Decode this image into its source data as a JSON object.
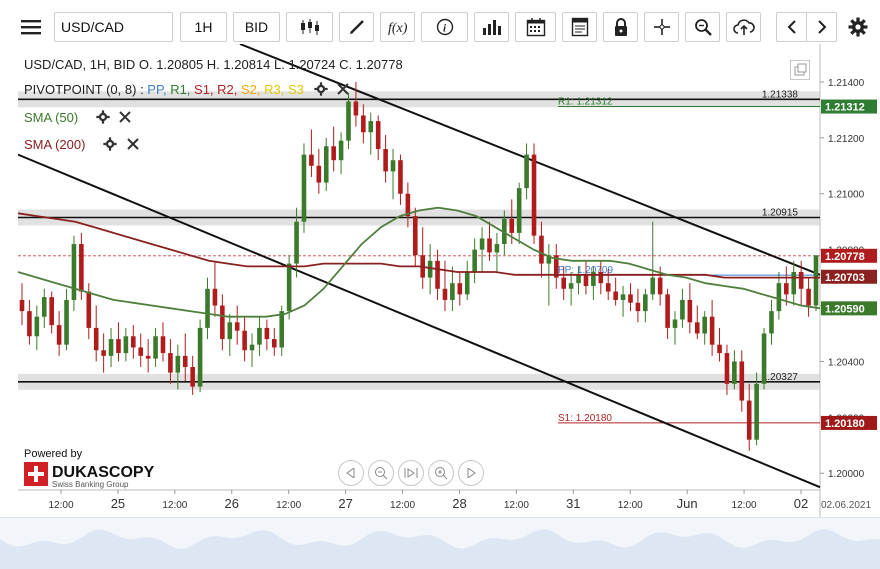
{
  "toolbar": {
    "symbol": "USD/CAD",
    "timeframe": "1H",
    "price_side": "BID",
    "icons": [
      "menu-icon",
      "candle-type-icon",
      "draw-icon",
      "function-icon",
      "info-icon",
      "indicators-icon",
      "calendar-icon",
      "report-icon",
      "lock-icon",
      "crosshair-icon",
      "zoom-icon",
      "upload-icon",
      "chevron-left-icon",
      "chevron-right-icon",
      "gear-icon"
    ]
  },
  "legend": {
    "ohlc": "USD/CAD, 1H, BID   O. 1.20805 H. 1.20814 L. 1.20724 C. 1.20778",
    "pivot_name": "PIVOTPOINT (0, 8)",
    "pivot_sep": " : ",
    "pivot_items": [
      {
        "label": "PP",
        "color": "#3b7fd6"
      },
      {
        "label": "R1",
        "color": "#2e7d32"
      },
      {
        "label": "S1",
        "color": "#b02424"
      },
      {
        "label": "R2",
        "color": "#b02424"
      },
      {
        "label": "S2",
        "color": "#f0a800"
      },
      {
        "label": "R3",
        "color": "#e6c800"
      },
      {
        "label": "S3",
        "color": "#e6c800"
      }
    ],
    "sma50": "SMA (50)",
    "sma200": "SMA (200)"
  },
  "branding": {
    "powered_by": "Powered by",
    "brand": "DUKASCOPY",
    "brand_sub": "Swiss Banking Group"
  },
  "colors": {
    "up": "#3a7a2a",
    "down": "#b01c1c",
    "sma50": "#4f7f3c",
    "sma200": "#8b2020",
    "pp": "#3b7fd6",
    "r1": "#2e7d32",
    "s1": "#b02424",
    "band": "#c9c9c9",
    "trend": "#111111"
  },
  "chart_data": {
    "type": "candlestick",
    "symbol": "USD/CAD",
    "ylim": [
      1.1994,
      1.215
    ],
    "yticks": [
      1.2,
      1.202,
      1.204,
      1.206,
      1.208,
      1.21,
      1.212,
      1.214
    ],
    "xticks": [
      "12:00",
      "25",
      "12:00",
      "26",
      "12:00",
      "27",
      "12:00",
      "28",
      "12:00",
      "31",
      "12:00",
      "Jun",
      "12:00",
      "02"
    ],
    "date_label": "02.06.2021",
    "pivot_levels": [
      {
        "name": "R1",
        "value": 1.21312,
        "label": "R1: 1.21312"
      },
      {
        "name": "PP",
        "value": 1.20709,
        "label": "PP: 1.20709"
      },
      {
        "name": "S1",
        "value": 1.2018,
        "label": "S1: 1.20180"
      }
    ],
    "support_resistance": [
      1.21338,
      1.20915,
      1.20327
    ],
    "last_price": 1.20778,
    "sma50_last": 1.2059,
    "sma200_last": 1.20703,
    "price_tags": [
      {
        "label": "1.21312",
        "value": 1.21312,
        "color": "#2e7d32"
      },
      {
        "label": "1.20778",
        "value": 1.20778,
        "color": "#b01c1c"
      },
      {
        "label": "1.20703",
        "value": 1.20703,
        "color": "#8b2020"
      },
      {
        "label": "1.20590",
        "value": 1.2059,
        "color": "#3a7a2a"
      },
      {
        "label": "1.20180",
        "value": 1.2018,
        "color": "#a01818"
      }
    ],
    "candles": [
      [
        1.2062,
        1.2068,
        1.2053,
        1.2058
      ],
      [
        1.2058,
        1.2062,
        1.2046,
        1.2049
      ],
      [
        1.2049,
        1.206,
        1.2044,
        1.2056
      ],
      [
        1.2056,
        1.2066,
        1.2052,
        1.2063
      ],
      [
        1.2063,
        1.2065,
        1.205,
        1.2053
      ],
      [
        1.2053,
        1.2058,
        1.2042,
        1.2046
      ],
      [
        1.2046,
        1.2066,
        1.2044,
        1.2062
      ],
      [
        1.2062,
        1.2085,
        1.2058,
        1.2082
      ],
      [
        1.2082,
        1.2086,
        1.2062,
        1.2065
      ],
      [
        1.2065,
        1.2068,
        1.2048,
        1.2052
      ],
      [
        1.2052,
        1.206,
        1.204,
        1.2044
      ],
      [
        1.2044,
        1.205,
        1.2036,
        1.2042
      ],
      [
        1.2042,
        1.2052,
        1.2038,
        1.2048
      ],
      [
        1.2048,
        1.2054,
        1.204,
        1.2043
      ],
      [
        1.2043,
        1.2052,
        1.204,
        1.2049
      ],
      [
        1.2049,
        1.2053,
        1.2041,
        1.2045
      ],
      [
        1.2045,
        1.205,
        1.2038,
        1.2042
      ],
      [
        1.2042,
        1.2048,
        1.2036,
        1.2041
      ],
      [
        1.2041,
        1.2052,
        1.2038,
        1.2049
      ],
      [
        1.2049,
        1.2054,
        1.204,
        1.2043
      ],
      [
        1.2043,
        1.2048,
        1.2032,
        1.2036
      ],
      [
        1.2036,
        1.2046,
        1.203,
        1.2042
      ],
      [
        1.2042,
        1.205,
        1.2033,
        1.2038
      ],
      [
        1.2038,
        1.2042,
        1.2028,
        1.2031
      ],
      [
        1.2031,
        1.2055,
        1.2029,
        1.2052
      ],
      [
        1.2052,
        1.207,
        1.2048,
        1.2066
      ],
      [
        1.2066,
        1.2076,
        1.2056,
        1.206
      ],
      [
        1.206,
        1.2064,
        1.2044,
        1.2048
      ],
      [
        1.2048,
        1.2057,
        1.2042,
        1.2054
      ],
      [
        1.2054,
        1.206,
        1.2046,
        1.2051
      ],
      [
        1.2051,
        1.2056,
        1.204,
        1.2044
      ],
      [
        1.2044,
        1.205,
        1.2038,
        1.2046
      ],
      [
        1.2046,
        1.2056,
        1.2042,
        1.2052
      ],
      [
        1.2052,
        1.2055,
        1.2044,
        1.2048
      ],
      [
        1.2048,
        1.2052,
        1.2042,
        1.2045
      ],
      [
        1.2045,
        1.206,
        1.2042,
        1.2058
      ],
      [
        1.2058,
        1.2078,
        1.2055,
        1.2075
      ],
      [
        1.2075,
        1.2095,
        1.207,
        1.209
      ],
      [
        1.209,
        1.2118,
        1.2086,
        1.2114
      ],
      [
        1.2114,
        1.2123,
        1.2106,
        1.211
      ],
      [
        1.211,
        1.2116,
        1.21,
        1.2104
      ],
      [
        1.2104,
        1.212,
        1.2101,
        1.2117
      ],
      [
        1.2117,
        1.2124,
        1.2108,
        1.2112
      ],
      [
        1.2112,
        1.2122,
        1.2107,
        1.2119
      ],
      [
        1.2119,
        1.2136,
        1.2116,
        1.2133
      ],
      [
        1.2133,
        1.214,
        1.2124,
        1.2128
      ],
      [
        1.2128,
        1.2132,
        1.2118,
        1.2122
      ],
      [
        1.2122,
        1.2129,
        1.2114,
        1.2126
      ],
      [
        1.2126,
        1.2128,
        1.2112,
        1.2116
      ],
      [
        1.2116,
        1.2121,
        1.2104,
        1.2108
      ],
      [
        1.2108,
        1.2116,
        1.2098,
        1.2112
      ],
      [
        1.2112,
        1.2114,
        1.2096,
        1.21
      ],
      [
        1.21,
        1.2104,
        1.2088,
        1.2092
      ],
      [
        1.2092,
        1.2095,
        1.2074,
        1.2078
      ],
      [
        1.2078,
        1.2088,
        1.2066,
        1.207
      ],
      [
        1.207,
        1.2082,
        1.2064,
        1.2076
      ],
      [
        1.2076,
        1.208,
        1.2062,
        1.2066
      ],
      [
        1.2066,
        1.2076,
        1.2058,
        1.2062
      ],
      [
        1.2062,
        1.2074,
        1.2058,
        1.2068
      ],
      [
        1.2068,
        1.2072,
        1.206,
        1.2064
      ],
      [
        1.2064,
        1.2076,
        1.2062,
        1.2072
      ],
      [
        1.2072,
        1.2084,
        1.2068,
        1.208
      ],
      [
        1.208,
        1.2088,
        1.2072,
        1.2084
      ],
      [
        1.2084,
        1.209,
        1.2076,
        1.2079
      ],
      [
        1.2079,
        1.2086,
        1.2072,
        1.2082
      ],
      [
        1.2082,
        1.2094,
        1.2078,
        1.2091
      ],
      [
        1.2091,
        1.2098,
        1.2082,
        1.2086
      ],
      [
        1.2086,
        1.2104,
        1.2082,
        1.2102
      ],
      [
        1.2102,
        1.2118,
        1.2098,
        1.2114
      ],
      [
        1.2114,
        1.2118,
        1.2082,
        1.2085
      ],
      [
        1.2085,
        1.209,
        1.207,
        1.2075
      ],
      [
        1.2075,
        1.2082,
        1.206,
        1.2078
      ],
      [
        1.2078,
        1.2082,
        1.2066,
        1.207
      ],
      [
        1.207,
        1.2074,
        1.2062,
        1.2066
      ],
      [
        1.2066,
        1.2072,
        1.206,
        1.2068
      ],
      [
        1.2068,
        1.2074,
        1.2064,
        1.2071
      ],
      [
        1.2071,
        1.2076,
        1.2064,
        1.2067
      ],
      [
        1.2067,
        1.2074,
        1.2062,
        1.2072
      ],
      [
        1.2072,
        1.2076,
        1.2064,
        1.2068
      ],
      [
        1.2068,
        1.2073,
        1.2062,
        1.2065
      ],
      [
        1.2065,
        1.207,
        1.206,
        1.2062
      ],
      [
        1.2062,
        1.2067,
        1.2056,
        1.2064
      ],
      [
        1.2064,
        1.2068,
        1.2058,
        1.2061
      ],
      [
        1.2061,
        1.2066,
        1.2054,
        1.2058
      ],
      [
        1.2058,
        1.2066,
        1.2054,
        1.2064
      ],
      [
        1.2064,
        1.209,
        1.2062,
        1.207
      ],
      [
        1.207,
        1.2074,
        1.206,
        1.2064
      ],
      [
        1.2064,
        1.2066,
        1.2048,
        1.2052
      ],
      [
        1.2052,
        1.2058,
        1.2046,
        1.2055
      ],
      [
        1.2055,
        1.2066,
        1.2052,
        1.2062
      ],
      [
        1.2062,
        1.2068,
        1.205,
        1.2054
      ],
      [
        1.2054,
        1.206,
        1.2048,
        1.205
      ],
      [
        1.205,
        1.2058,
        1.2046,
        1.2056
      ],
      [
        1.2056,
        1.2062,
        1.2042,
        1.2046
      ],
      [
        1.2046,
        1.2052,
        1.204,
        1.2043
      ],
      [
        1.2043,
        1.2046,
        1.2028,
        1.2032
      ],
      [
        1.2032,
        1.2044,
        1.203,
        1.204
      ],
      [
        1.204,
        1.2044,
        1.2022,
        1.2026
      ],
      [
        1.2026,
        1.2032,
        1.2008,
        1.2012
      ],
      [
        1.2012,
        1.2036,
        1.201,
        1.2032
      ],
      [
        1.2032,
        1.2052,
        1.203,
        1.205
      ],
      [
        1.205,
        1.2062,
        1.2046,
        1.2058
      ],
      [
        1.2058,
        1.2072,
        1.2055,
        1.2068
      ],
      [
        1.2068,
        1.2074,
        1.206,
        1.2064
      ],
      [
        1.2064,
        1.2076,
        1.206,
        1.2072
      ],
      [
        1.2072,
        1.2076,
        1.206,
        1.2066
      ],
      [
        1.2066,
        1.207,
        1.2056,
        1.206
      ],
      [
        1.206,
        1.2072,
        1.2058,
        1.2078
      ]
    ],
    "sma50": [
      1.2072,
      1.207,
      1.2068,
      1.2066,
      1.2064,
      1.2062,
      1.2061,
      1.206,
      1.2059,
      1.2058,
      1.2057,
      1.2056,
      1.2056,
      1.2056,
      1.2057,
      1.206,
      1.2066,
      1.2074,
      1.2082,
      1.2088,
      1.2092,
      1.2094,
      1.2095,
      1.2094,
      1.2092,
      1.2088,
      1.2084,
      1.208,
      1.2077,
      1.2076,
      1.2076,
      1.2076,
      1.2075,
      1.2073,
      1.2071,
      1.207,
      1.2068,
      1.2067,
      1.2066,
      1.2064,
      1.2062,
      1.206,
      1.2059
    ],
    "sma200": [
      1.2093,
      1.2092,
      1.2091,
      1.209,
      1.2088,
      1.2086,
      1.2084,
      1.2082,
      1.208,
      1.2078,
      1.2076,
      1.2075,
      1.2074,
      1.2074,
      1.2074,
      1.2074,
      1.2075,
      1.2075,
      1.2075,
      1.2075,
      1.2074,
      1.2074,
      1.2073,
      1.2072,
      1.2072,
      1.2072,
      1.2071,
      1.2071,
      1.2071,
      1.2071,
      1.2071,
      1.2071,
      1.2071,
      1.2071,
      1.2071,
      1.2071,
      1.2071,
      1.207,
      1.207,
      1.207,
      1.207,
      1.207,
      1.207
    ],
    "channel_upper": [
      [
        1.215,
        0
      ],
      [
        1.2071,
        1
      ]
    ],
    "channel_lower": [
      [
        1.2114,
        0
      ],
      [
        1.1994,
        1
      ]
    ]
  }
}
